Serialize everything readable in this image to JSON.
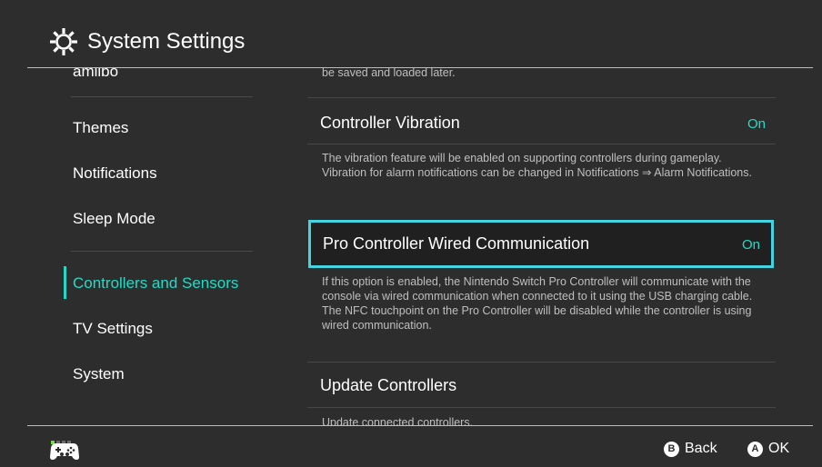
{
  "header": {
    "title": "System Settings",
    "icon": "gear-icon"
  },
  "nav": {
    "partial_top": "amiibo",
    "items": [
      {
        "label": "Themes"
      },
      {
        "label": "Notifications"
      },
      {
        "label": "Sleep Mode"
      },
      {
        "label": "Controllers and Sensors",
        "active": true
      },
      {
        "label": "TV Settings"
      },
      {
        "label": "System"
      }
    ]
  },
  "content": {
    "partial_top_desc": "be saved and loaded later.",
    "settings": [
      {
        "title": "Controller Vibration",
        "value": "On",
        "description": "The vibration feature will be enabled on supporting controllers during gameplay. Vibration for alarm notifications can be changed in Notifications ⇒ Alarm Notifications."
      },
      {
        "title": "Pro Controller Wired Communication",
        "value": "On",
        "selected": true,
        "description": "If this option is enabled, the Nintendo Switch Pro Controller will communicate with the console via wired communication when connected to it using the USB charging cable. The NFC touchpoint on the Pro Controller will be disabled while the controller is using wired communication."
      },
      {
        "title": "Update Controllers",
        "description": "Update connected controllers."
      }
    ]
  },
  "footer": {
    "controller_icon": "controller-icon",
    "back": {
      "button": "B",
      "label": "Back"
    },
    "ok": {
      "button": "A",
      "label": "OK"
    }
  },
  "colors": {
    "background": "#2d2d2d",
    "accent": "#20dcc8",
    "selection_border": "#44d3e0"
  }
}
